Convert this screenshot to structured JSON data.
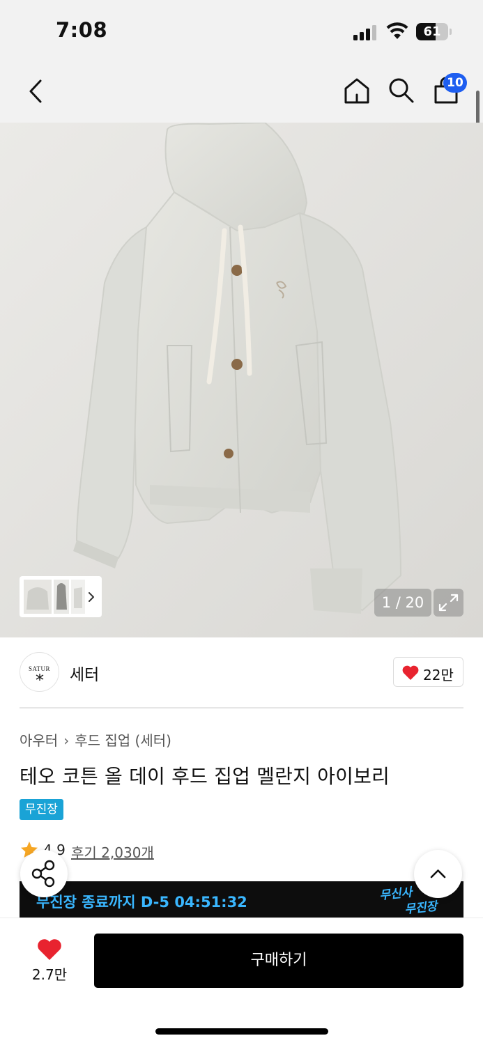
{
  "status_bar": {
    "time": "7:08",
    "battery_level": "61",
    "battery_fraction": 0.61
  },
  "nav": {
    "back_icon": "chevron-left-icon",
    "home_icon": "home-icon",
    "search_icon": "search-icon",
    "cart_icon": "shopping-bag-icon",
    "cart_count": "10"
  },
  "gallery": {
    "counter": "1 / 20",
    "expand_icon": "expand-icon",
    "thumbnail_arrow_icon": "chevron-right-icon"
  },
  "brand": {
    "logo_text": "SATUR",
    "name": "세터",
    "like_count": "22만"
  },
  "product": {
    "breadcrumb": [
      "아우터",
      "후드 집업 (세터)"
    ],
    "title": "테오 코튼 올 데이 후드 집업 멜란지 아이보리",
    "tag": "무진장",
    "rating": "4.9",
    "reviews": "후기 2,030개"
  },
  "promo": {
    "text": "무진장 종료까지 D-5 04:51:32",
    "logo_line1": "무신사",
    "logo_line2": "무진장"
  },
  "bottom": {
    "wish_count": "2.7만",
    "buy_label": "구매하기"
  },
  "colors": {
    "accent_blue": "#1e5ef0",
    "tag_blue": "#1aa3d6",
    "promo_text": "#3ab7ff",
    "heart_red": "#e8232f"
  }
}
